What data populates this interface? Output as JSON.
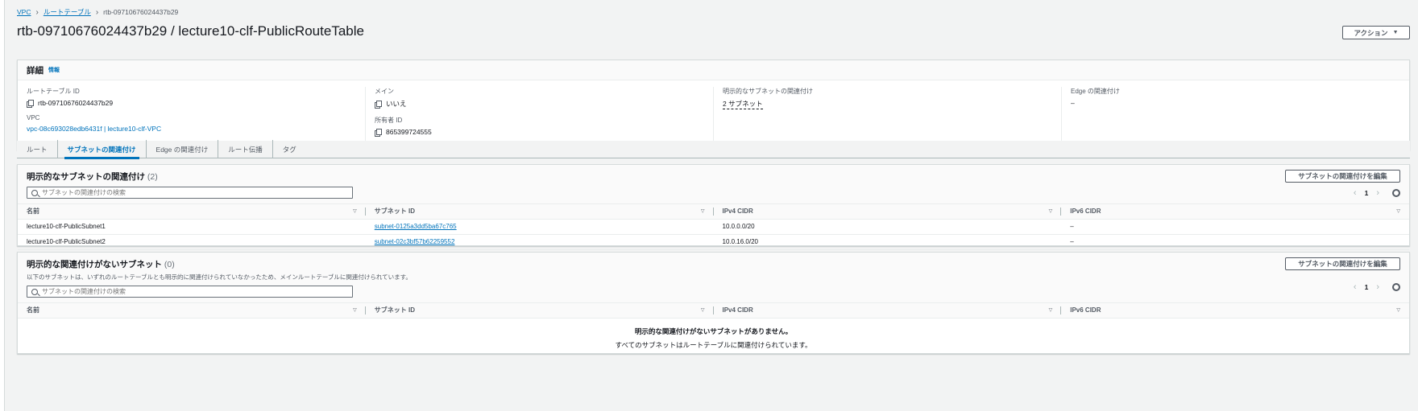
{
  "breadcrumb": {
    "items": [
      "VPC",
      "ルートテーブル"
    ],
    "current": "rtb-09710676024437b29"
  },
  "page": {
    "title": "rtb-09710676024437b29 / lecture10-clf-PublicRouteTable",
    "action_label": "アクション"
  },
  "details": {
    "title": "詳細",
    "info": "情報",
    "route_table_id_label": "ルートテーブル ID",
    "route_table_id": "rtb-09710676024437b29",
    "vpc_label": "VPC",
    "vpc_value": "vpc-08c693028edb6431f | lecture10-clf-VPC",
    "main_label": "メイン",
    "main_value": "いいえ",
    "owner_label": "所有者 ID",
    "owner_value": "865399724555",
    "explicit_label": "明示的なサブネットの関連付け",
    "explicit_value": "2 サブネット",
    "edge_label": "Edge の関連付け",
    "edge_value": "–"
  },
  "tabs": [
    {
      "label": "ルート",
      "active": false
    },
    {
      "label": "サブネットの関連付け",
      "active": true
    },
    {
      "label": "Edge の関連付け",
      "active": false
    },
    {
      "label": "ルート伝播",
      "active": false
    },
    {
      "label": "タグ",
      "active": false
    }
  ],
  "explicit_section": {
    "title": "明示的なサブネットの関連付け",
    "count": "(2)",
    "edit_label": "サブネットの関連付けを編集",
    "search_placeholder": "サブネットの関連付けの検索",
    "page": "1",
    "columns": [
      "名前",
      "サブネット ID",
      "IPv4 CIDR",
      "IPv6 CIDR"
    ],
    "rows": [
      {
        "name": "lecture10-clf-PublicSubnet1",
        "subnet_id": "subnet-0125a3dd5ba67c765",
        "ipv4": "10.0.0.0/20",
        "ipv6": "–"
      },
      {
        "name": "lecture10-clf-PublicSubnet2",
        "subnet_id": "subnet-02c3bf57b62259552",
        "ipv4": "10.0.16.0/20",
        "ipv6": "–"
      }
    ]
  },
  "unassoc_section": {
    "title": "明示的な関連付けがないサブネット",
    "count": "(0)",
    "description": "以下のサブネットは、いずれのルートテーブルとも明示的に関連付けられていなかったため、メインルートテーブルに関連付けられています。",
    "edit_label": "サブネットの関連付けを編集",
    "search_placeholder": "サブネットの関連付けの検索",
    "page": "1",
    "columns": [
      "名前",
      "サブネット ID",
      "IPv4 CIDR",
      "IPv6 CIDR"
    ],
    "empty_title": "明示的な関連付けがないサブネットがありません。",
    "empty_desc": "すべてのサブネットはルートテーブルに関連付けられています。"
  }
}
